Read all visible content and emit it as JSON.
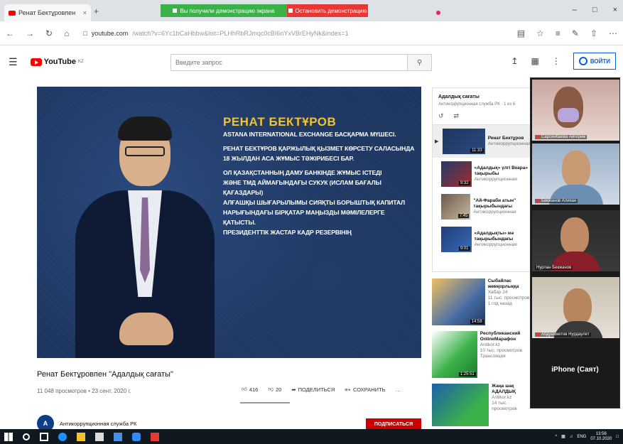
{
  "browser": {
    "tab_title": "Ренат Бектұровпен",
    "tab_close": "×",
    "new_tab": "+",
    "share_notice": "Вы получили демонстрацию экрана",
    "stop_share": "Остановить демонстрацию",
    "window_controls": [
      "–",
      "□",
      "×"
    ],
    "url_host": "youtube.com",
    "url_rest": "/watch?v=6Yc1bCaHbbw&list=PLHhRbRJmqc0cBI6nYxVBrEHyNk&index=1",
    "nav_icons": [
      "back-icon",
      "forward-icon",
      "refresh-icon",
      "home-icon"
    ]
  },
  "youtube": {
    "logo_text": "YouTube",
    "logo_region": "KZ",
    "search_placeholder": "Введите запрос",
    "signin_label": "ВОЙТИ"
  },
  "video": {
    "overlay_name": "РЕНАТ БЕКТҰРОВ",
    "overlay_lines": [
      "ASTANA INTERNATIONAL EXCHANGE БАСҚАРМА МҮШЕСІ.",
      "РЕНАТ БЕКТҰРОВ ҚАРЖЫЛЫҚ ҚЫЗМЕТ КӨРСЕТУ САЛАСЫНДА",
      "18 ЖЫЛДАН АСА ЖҰМЫС ТӘЖІРИБЕСІ БАР.",
      "ОЛ ҚАЗАҚСТАННЫҢ ДАМУ БАНКІНДЕ ЖҰМЫС ІСТЕДІ",
      "ЖӘНЕ ТМД АЙМАҒЫНДАҒЫ СУКУК (ИСЛАМ БАҒАЛЫ ҚАҒАЗДАРЫ)",
      "АЛҒАШҚЫ ШЫҒАРЫЛЫМЫ СИЯҚТЫ БОРЫШТЫҚ КАПИТАЛ",
      "НАРЫҒЫНДАҒЫ БІРҚАТАР МАҢЫЗДЫ МӘМІЛЕЛЕРГЕ ҚАТЫСТЫ.",
      "ПРЕЗИДЕНТТІК ЖАСТАР КАДР РЕЗЕРВІНІҢ"
    ],
    "title": "Ренат Бектұровпен \"Адалдық сағаты\"",
    "meta": "11 048 просмотров • 23 сент. 2020 г.",
    "likes": "416",
    "dislikes": "20",
    "share": "ПОДЕЛИТЬСЯ",
    "save": "СОХРАНИТЬ",
    "more": "…",
    "channel": "Антикоррупционная служба РК",
    "channel_initial": "A",
    "subscribe": "ПОДПИСАТЬСЯ"
  },
  "playlist": {
    "title": "Адалдық сағаты",
    "subtitle": "Антикоррупционная служба РК · 1 из 6",
    "items": [
      {
        "title": "Ренат Бектұров",
        "channel": "Антикоррупционная",
        "duration": "11:33"
      },
      {
        "title": "«Адалдық» үлгі Вкара» тақырыбы",
        "channel": "Антикоррупционная",
        "duration": "9:32"
      },
      {
        "title": "\"Ай-Фараби атын\" тақырыбындағы",
        "channel": "Антикоррупционная",
        "duration": "7:45"
      },
      {
        "title": "«Адалдықты» мә тақырыбындағы",
        "channel": "Антикоррупционная",
        "duration": "9:01"
      }
    ]
  },
  "recommendations": [
    {
      "title": "Сыбайлас жемқорлыққа",
      "channel": "Хабар 24",
      "meta": "11 тыс. просмотров",
      "extra": "1 год назад",
      "duration": "14:58"
    },
    {
      "title": "Республиканский OnlineМарафон",
      "channel": "Antikor.kz",
      "meta": "10 тыс. просмотров",
      "extra": "Трансляция",
      "duration": "1:25:51"
    },
    {
      "title": "Жаңа шақ АДАЛДЫҚ",
      "channel": "Antikor.kz",
      "meta": "14 тыс. просмотров",
      "extra": "",
      "duration": ""
    }
  ],
  "zoom": {
    "participants": [
      {
        "name": "Сарсенбаева Айгерим"
      },
      {
        "name": "Бекжанов Алихан"
      },
      {
        "name": "Нурлан Бекжанов"
      },
      {
        "name": "Абдуахметов Нурдаулет"
      }
    ],
    "phone_label": "iPhone (Саят)"
  },
  "taskbar": {
    "time": "13:56",
    "date": "07.10.2020",
    "lang": "ENG"
  },
  "colors": {
    "youtube_red": "#ff0000",
    "share_green": "#3cb14a",
    "stop_red": "#e53935",
    "signin_blue": "#065fd4",
    "overlay_yellow": "#f2c230"
  }
}
